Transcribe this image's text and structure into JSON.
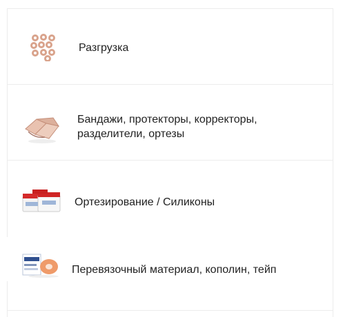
{
  "categories": [
    {
      "label": "Разгрузка",
      "icon": "foam-rings-icon"
    },
    {
      "label": "Бандажи, протекторы, корректоры, разделители, ортезы",
      "label_line1": "Бандажи, протекторы, корректоры,",
      "label_line2": "разделители, ортезы",
      "icon": "gel-bandage-icon"
    },
    {
      "label": "Ортезирование / Силиконы",
      "icon": "silicone-jars-icon"
    },
    {
      "label": "Перевязочный материал, кополин, тейп",
      "icon": "tape-box-icon"
    }
  ],
  "colors": {
    "border": "#ececec",
    "text": "#222222",
    "ring": "#d9a38c"
  }
}
